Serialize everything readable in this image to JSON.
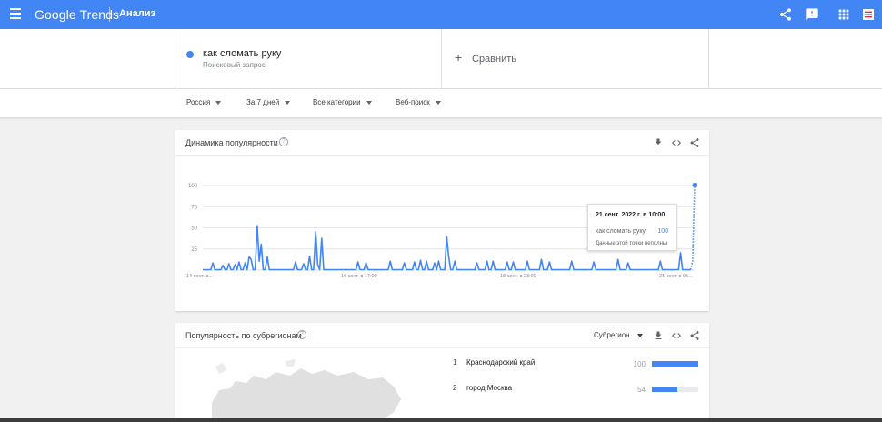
{
  "topbar": {
    "logo": "Google Trends",
    "section": "Анализ",
    "icons": [
      "share-icon",
      "feedback-icon",
      "apps-icon",
      "account-icon"
    ]
  },
  "term": {
    "name": "как сломать руку",
    "type": "Поисковый запрос",
    "color": "#4285f4"
  },
  "compare": {
    "label": "Сравнить"
  },
  "filters": [
    {
      "label": "Россия"
    },
    {
      "label": "За 7 дней"
    },
    {
      "label": "Все категории"
    },
    {
      "label": "Веб-поиск"
    }
  ],
  "interest_card": {
    "title": "Динамика популярности"
  },
  "chart_data": {
    "type": "line",
    "title": "Динамика популярности",
    "yticks": [
      "100",
      "75",
      "50",
      "25"
    ],
    "ylim": [
      0,
      100
    ],
    "xticks": [
      "14 сент. в...",
      "16 сент. в 17:00",
      "18 сент. в 23:00",
      "21 сент. в 05..."
    ],
    "grid": true,
    "series": [
      {
        "name": "как сломать руку",
        "color": "#4285f4",
        "values": [
          0,
          0,
          0,
          0,
          0,
          8,
          0,
          0,
          0,
          0,
          5,
          0,
          0,
          7,
          0,
          0,
          6,
          0,
          9,
          0,
          0,
          8,
          0,
          15,
          12,
          0,
          0,
          52,
          10,
          30,
          0,
          0,
          15,
          0,
          0,
          0,
          0,
          0,
          0,
          0,
          0,
          0,
          0,
          0,
          0,
          0,
          9,
          0,
          0,
          0,
          7,
          0,
          0,
          16,
          0,
          0,
          45,
          6,
          0,
          37,
          0,
          0,
          0,
          0,
          0,
          0,
          0,
          0,
          0,
          0,
          0,
          0,
          0,
          0,
          0,
          0,
          0,
          9,
          0,
          0,
          0,
          8,
          0,
          0,
          0,
          0,
          0,
          0,
          0,
          0,
          0,
          0,
          0,
          10,
          0,
          0,
          0,
          0,
          0,
          0,
          8,
          0,
          0,
          0,
          0,
          9,
          0,
          0,
          11,
          0,
          0,
          10,
          0,
          0,
          0,
          8,
          0,
          10,
          0,
          0,
          0,
          39,
          15,
          0,
          0,
          10,
          0,
          0,
          0,
          0,
          0,
          0,
          0,
          0,
          0,
          0,
          8,
          0,
          0,
          0,
          0,
          10,
          0,
          0,
          10,
          0,
          0,
          0,
          0,
          0,
          0,
          9,
          0,
          0,
          9,
          0,
          0,
          0,
          0,
          0,
          0,
          10,
          0,
          0,
          0,
          0,
          0,
          0,
          12,
          0,
          0,
          0,
          9,
          0,
          0,
          0,
          0,
          0,
          0,
          0,
          0,
          0,
          0,
          10,
          0,
          0,
          0,
          0,
          0,
          0,
          0,
          0,
          0,
          0,
          9,
          0,
          0,
          0,
          0,
          0,
          0,
          0,
          0,
          0,
          0,
          0,
          12,
          0,
          0,
          0,
          0,
          8,
          0,
          0,
          0,
          0,
          0,
          0,
          0,
          0,
          0,
          0,
          0,
          0,
          0,
          0,
          0,
          10,
          0,
          0,
          0,
          0,
          0,
          0,
          0,
          0,
          0,
          20,
          0,
          0,
          0,
          0,
          0,
          10,
          100
        ],
        "dotted_last_segments": 2
      }
    ]
  },
  "tooltip": {
    "date": "21 сент. 2022 г. в 10:00",
    "term": "как сломать руку",
    "value": "100",
    "note": "Данные этой точки неполны"
  },
  "regions_card": {
    "title": "Популярность по субрегионам",
    "selector": "Субрегион",
    "rows": [
      {
        "rank": "1",
        "name": "Краснодарский край",
        "value": "100",
        "fraction": 1.0
      },
      {
        "rank": "2",
        "name": "город Москва",
        "value": "54",
        "fraction": 0.54
      }
    ]
  }
}
